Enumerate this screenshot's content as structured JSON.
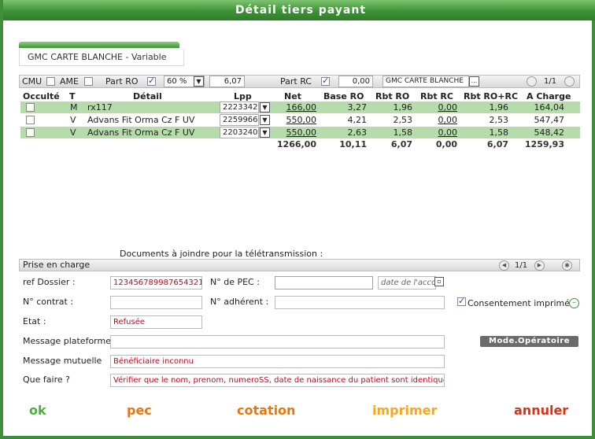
{
  "window": {
    "title": "Détail tiers payant"
  },
  "subtitle": "GMC CARTE BLANCHE - Variable",
  "toolbar": {
    "cmu": "CMU",
    "ame": "AME",
    "part_ro": "Part RO",
    "pct_value": "60 %",
    "ro_amount": "6,07",
    "part_rc": "Part RC",
    "rc_amount": "0,00",
    "rc_name": "GMC CARTE BLANCHE",
    "dots": "...",
    "pager": "1/1"
  },
  "table": {
    "headers": [
      "Occulté",
      "T",
      "Détail",
      "Lpp",
      "Net",
      "Base RO",
      "Rbt RO",
      "Rbt RC",
      "Rbt RO+RC",
      "A Charge"
    ],
    "rows": [
      {
        "t": "M",
        "detail": "rx117",
        "lpp": "2223342",
        "net": "166,00",
        "base_ro": "3,27",
        "rbt_ro": "1,96",
        "rbt_rc": "0,00",
        "rbt_rorc": "1,96",
        "charge": "164,04"
      },
      {
        "t": "V",
        "detail": "Advans Fit Orma Cz F UV",
        "lpp": "2259966",
        "net": "550,00",
        "base_ro": "4,21",
        "rbt_ro": "2,53",
        "rbt_rc": "0,00",
        "rbt_rorc": "2,53",
        "charge": "547,47"
      },
      {
        "t": "V",
        "detail": "Advans Fit Orma Cz F UV",
        "lpp": "2203240",
        "net": "550,00",
        "base_ro": "2,63",
        "rbt_ro": "1,58",
        "rbt_rc": "0,00",
        "rbt_rorc": "1,58",
        "charge": "548,42"
      }
    ],
    "totals": {
      "net": "1266,00",
      "base_ro": "10,11",
      "rbt_ro": "6,07",
      "rbt_rc": "0,00",
      "rbt_rorc": "6,07",
      "charge": "1259,93"
    }
  },
  "documents_label": "Documents à joindre pour la télétransmission :",
  "pec_bar": {
    "title": "Prise en charge",
    "pager": "1/1"
  },
  "form": {
    "ref_dossier_label": "ref Dossier :",
    "ref_dossier_value": "123456789987654321",
    "no_pec_label": "N° de PEC :",
    "no_pec_value": "",
    "date_accord_placeholder": "date de l'accord",
    "no_contrat_label": "N° contrat :",
    "no_contrat_value": "",
    "no_adherent_label": "N° adhérent :",
    "no_adherent_value": "",
    "consentement_label": "Consentement imprimé",
    "etat_label": "Etat :",
    "etat_value": "Refusée",
    "msg_plateforme_label": "Message plateforme",
    "msg_plateforme_value": "",
    "mode_operatoire": "Mode.Opératoire",
    "msg_mutuelle_label": "Message mutuelle",
    "msg_mutuelle_value": "Bénéficiaire inconnu",
    "que_faire_label": "Que faire ?",
    "que_faire_value": "Vérifier que le nom, prenom, numeroSS, date de naissance du patient sont identiques dans la carte"
  },
  "actions": {
    "ok": "ok",
    "pec": "pec",
    "cotation": "cotation",
    "imprimer": "imprimer",
    "annuler": "annuler"
  },
  "colors": {
    "title_green": "#3d9236",
    "row_green": "#b7dcab",
    "ok": "#4caf3f",
    "orange": "#e8760e",
    "orange_light": "#f5a623",
    "red": "#d0341b"
  }
}
